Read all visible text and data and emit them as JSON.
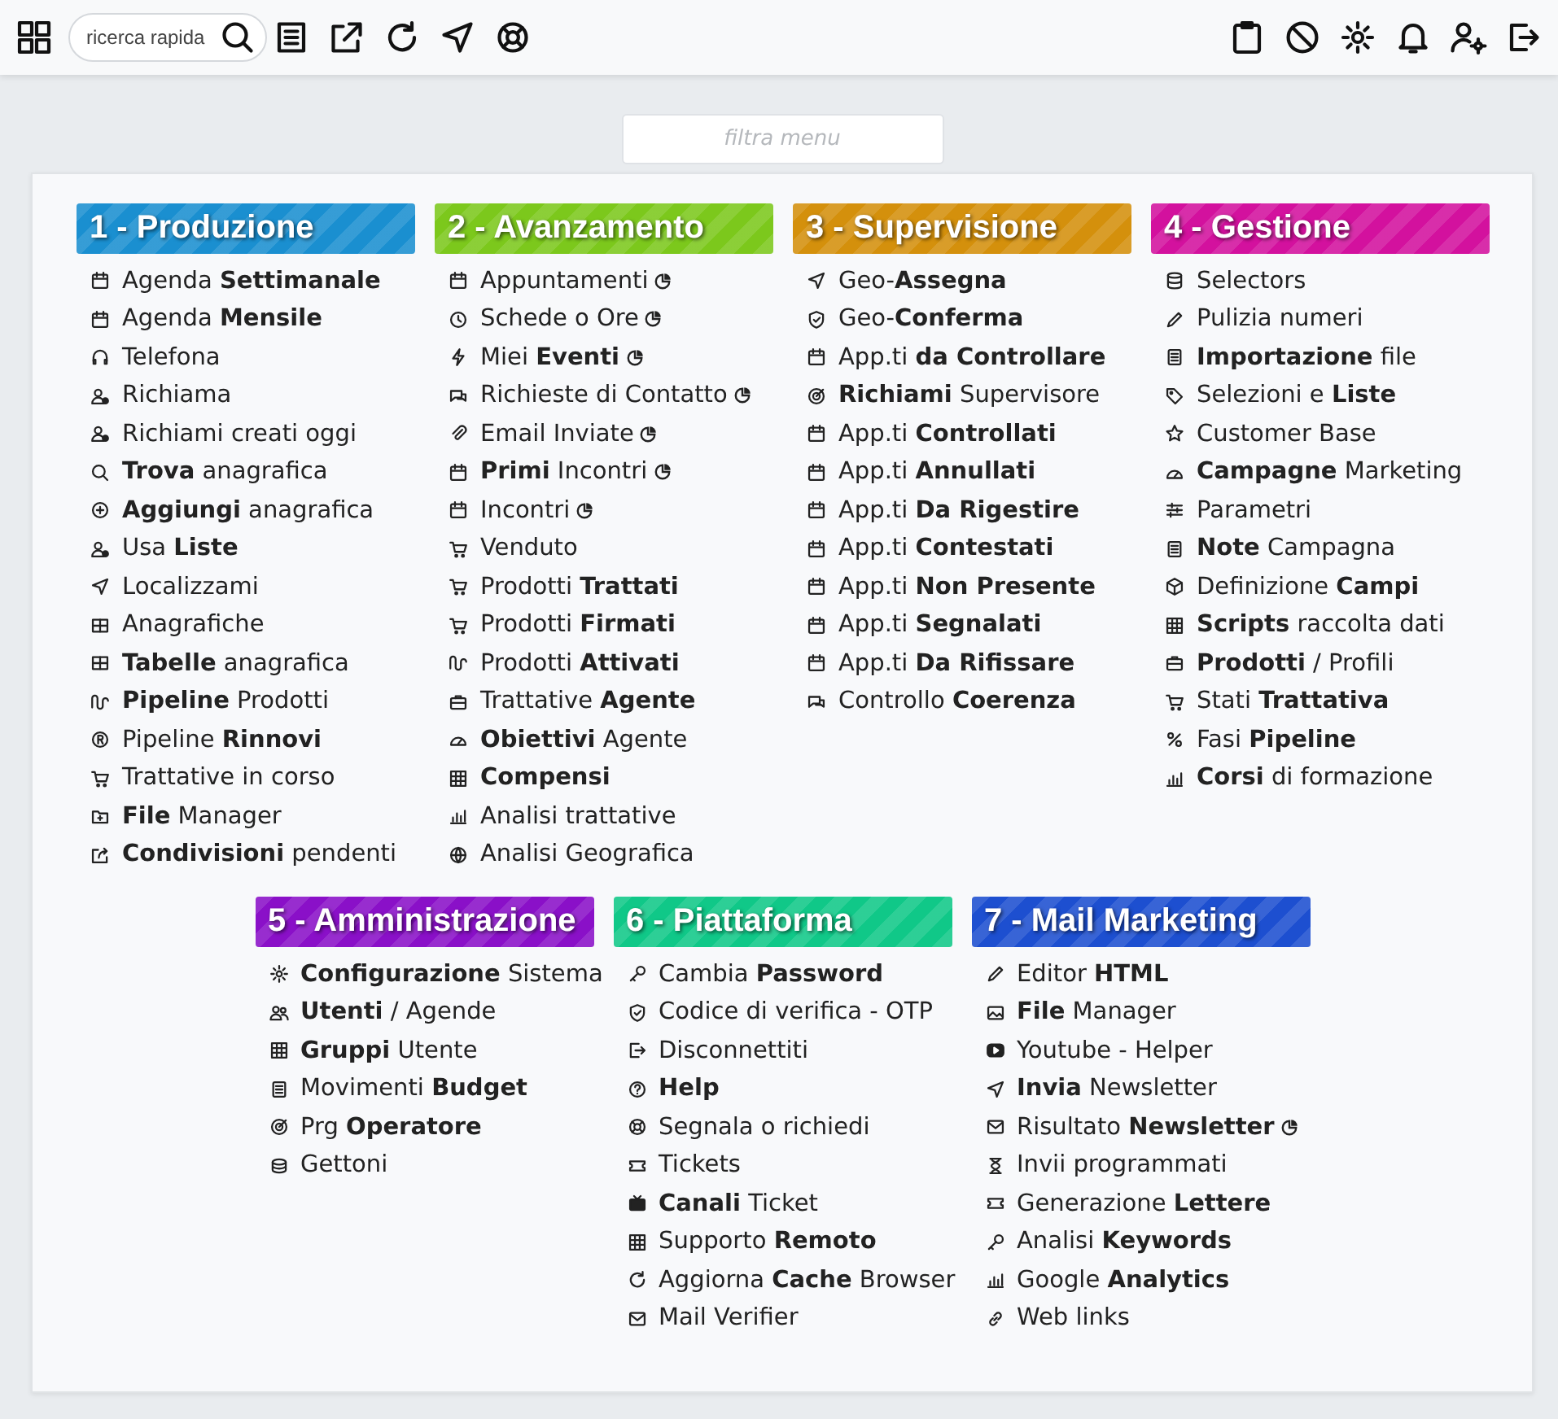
{
  "toolbar": {
    "search": {
      "placeholder": "ricerca rapida"
    }
  },
  "filter": {
    "placeholder": "filtra menu"
  },
  "sections": [
    {
      "title": "1 - Produzione",
      "color": "#1a8fd0",
      "items": [
        {
          "label": "Agenda **Settimanale**",
          "report": false
        },
        {
          "label": "Agenda **Mensile**",
          "report": false
        },
        {
          "label": "Telefona",
          "report": false
        },
        {
          "label": "Richiama",
          "report": false
        },
        {
          "label": "Richiami creati oggi",
          "report": false
        },
        {
          "label": "**Trova** anagrafica",
          "report": false
        },
        {
          "label": "**Aggiungi** anagrafica",
          "report": false
        },
        {
          "label": "Usa **Liste**",
          "report": false
        },
        {
          "label": "Localizzami",
          "report": false
        },
        {
          "label": "Anagrafiche",
          "report": false
        },
        {
          "label": "**Tabelle** anagrafica",
          "report": false
        },
        {
          "label": "**Pipeline** Prodotti",
          "report": false
        },
        {
          "label": "Pipeline **Rinnovi**",
          "report": false
        },
        {
          "label": "Trattative in corso",
          "report": false
        },
        {
          "label": "**File** Manager",
          "report": false
        },
        {
          "label": "**Condivisioni** pendenti",
          "report": false
        }
      ]
    },
    {
      "title": "2 - Avanzamento",
      "color": "#7cc81c",
      "items": [
        {
          "label": "Appuntamenti",
          "report": true
        },
        {
          "label": "Schede o Ore",
          "report": true
        },
        {
          "label": "Miei **Eventi**",
          "report": true
        },
        {
          "label": "Richieste di Contatto",
          "report": true
        },
        {
          "label": "Email Inviate",
          "report": true
        },
        {
          "label": "**Primi** Incontri",
          "report": true
        },
        {
          "label": "Incontri",
          "report": true
        },
        {
          "label": "Venduto",
          "report": false
        },
        {
          "label": "Prodotti **Trattati**",
          "report": false
        },
        {
          "label": "Prodotti **Firmati**",
          "report": false
        },
        {
          "label": "Prodotti **Attivati**",
          "report": false
        },
        {
          "label": "Trattative **Agente**",
          "report": false
        },
        {
          "label": "**Obiettivi** Agente",
          "report": false
        },
        {
          "label": "**Compensi**",
          "report": false
        },
        {
          "label": "Analisi trattative",
          "report": false
        },
        {
          "label": "Analisi Geografica",
          "report": false
        }
      ]
    },
    {
      "title": "3 - Supervisione",
      "color": "#d4900c",
      "items": [
        {
          "label": "Geo-**Assegna**",
          "report": false
        },
        {
          "label": "Geo-**Conferma**",
          "report": false
        },
        {
          "label": "App.ti **da Controllare**",
          "report": false
        },
        {
          "label": "**Richiami** Supervisore",
          "report": false
        },
        {
          "label": "App.ti **Controllati**",
          "report": false
        },
        {
          "label": "App.ti **Annullati**",
          "report": false
        },
        {
          "label": "App.ti **Da Rigestire**",
          "report": false
        },
        {
          "label": "App.ti **Contestati**",
          "report": false
        },
        {
          "label": "App.ti **Non Presente**",
          "report": false
        },
        {
          "label": "App.ti **Segnalati**",
          "report": false
        },
        {
          "label": "App.ti **Da Rifissare**",
          "report": false
        },
        {
          "label": "Controllo **Coerenza**",
          "report": false
        }
      ]
    },
    {
      "title": "4 - Gestione",
      "color": "#d3119e",
      "items": [
        {
          "label": "Selectors",
          "report": false
        },
        {
          "label": "Pulizia numeri",
          "report": false
        },
        {
          "label": "**Importazione** file",
          "report": false
        },
        {
          "label": "Selezioni e **Liste**",
          "report": false
        },
        {
          "label": "Customer Base",
          "report": false
        },
        {
          "label": "**Campagne** Marketing",
          "report": false
        },
        {
          "label": "Parametri",
          "report": false
        },
        {
          "label": "**Note** Campagna",
          "report": false
        },
        {
          "label": "Definizione **Campi**",
          "report": false
        },
        {
          "label": "**Scripts** raccolta dati",
          "report": false
        },
        {
          "label": "**Prodotti** / Profili",
          "report": false
        },
        {
          "label": "Stati **Trattativa**",
          "report": false
        },
        {
          "label": "Fasi **Pipeline**",
          "report": false
        },
        {
          "label": "**Corsi** di formazione",
          "report": false
        }
      ]
    },
    {
      "title": "5 - Amministrazione",
      "color": "#8a10c8",
      "items": [
        {
          "label": "**Configurazione** Sistema",
          "report": false
        },
        {
          "label": "**Utenti** / Agende",
          "report": false
        },
        {
          "label": "**Gruppi** Utente",
          "report": false
        },
        {
          "label": "Movimenti **Budget**",
          "report": false
        },
        {
          "label": "Prg **Operatore**",
          "report": false
        },
        {
          "label": "Gettoni",
          "report": false
        }
      ]
    },
    {
      "title": "6 - Piattaforma",
      "color": "#10c888",
      "items": [
        {
          "label": "Cambia **Password**",
          "report": false
        },
        {
          "label": "Codice di verifica - OTP",
          "report": false
        },
        {
          "label": "Disconnettiti",
          "report": false
        },
        {
          "label": "**Help**",
          "report": false
        },
        {
          "label": "Segnala o richiedi",
          "report": false
        },
        {
          "label": "Tickets",
          "report": false
        },
        {
          "label": "**Canali** Ticket",
          "report": false
        },
        {
          "label": "Supporto **Remoto**",
          "report": false
        },
        {
          "label": "Aggiorna **Cache** Browser",
          "report": false
        },
        {
          "label": "Mail Verifier",
          "report": false
        }
      ]
    },
    {
      "title": "7 - Mail Marketing",
      "color": "#1d4fd0",
      "items": [
        {
          "label": "Editor **HTML**",
          "report": false
        },
        {
          "label": "**File** Manager",
          "report": false
        },
        {
          "label": "Youtube - Helper",
          "report": false
        },
        {
          "label": "**Invia** Newsletter",
          "report": false
        },
        {
          "label": "Risultato **Newsletter**",
          "report": true
        },
        {
          "label": "Invii programmati",
          "report": false
        },
        {
          "label": "Generazione **Lettere**",
          "report": false
        },
        {
          "label": "Analisi **Keywords**",
          "report": false
        },
        {
          "label": "Google **Analytics**",
          "report": false
        },
        {
          "label": "Web links",
          "report": false
        }
      ]
    }
  ]
}
